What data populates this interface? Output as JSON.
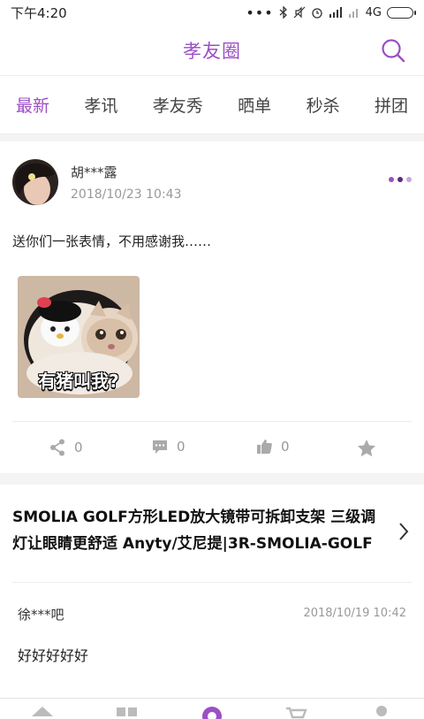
{
  "status": {
    "time": "下午4:20",
    "network": "4G",
    "icons": [
      "more-dots-icon",
      "bluetooth-icon",
      "mute-icon",
      "alarm-icon",
      "signal-icon",
      "signal-empty-icon",
      "battery-icon"
    ]
  },
  "header": {
    "title": "孝友圈",
    "search_icon": "search-icon",
    "accent_color": "#9b4fc4"
  },
  "tabs": [
    {
      "label": "最新",
      "active": true
    },
    {
      "label": "孝讯",
      "active": false
    },
    {
      "label": "孝友秀",
      "active": false
    },
    {
      "label": "晒单",
      "active": false
    },
    {
      "label": "秒杀",
      "active": false
    },
    {
      "label": "拼团",
      "active": false
    }
  ],
  "post": {
    "username": "胡***露",
    "time": "2018/10/23 10:43",
    "text": "送你们一张表情，不用感谢我……",
    "image_caption": "有猪叫我?",
    "share_count": "0",
    "comment_count": "0",
    "like_count": "0"
  },
  "product": {
    "title": "SMOLIA GOLF方形LED放大镜带可拆卸支架 三级调灯让眼睛更舒适 Anyty/艾尼提|3R-SMOLIA-GOLF",
    "comment": {
      "user": "徐***吧",
      "time": "2018/10/19 10:42",
      "text": "好好好好好"
    }
  },
  "bottom_nav": {
    "icons": [
      "home-icon",
      "category-icon",
      "circle-icon",
      "cart-icon",
      "profile-icon"
    ]
  }
}
